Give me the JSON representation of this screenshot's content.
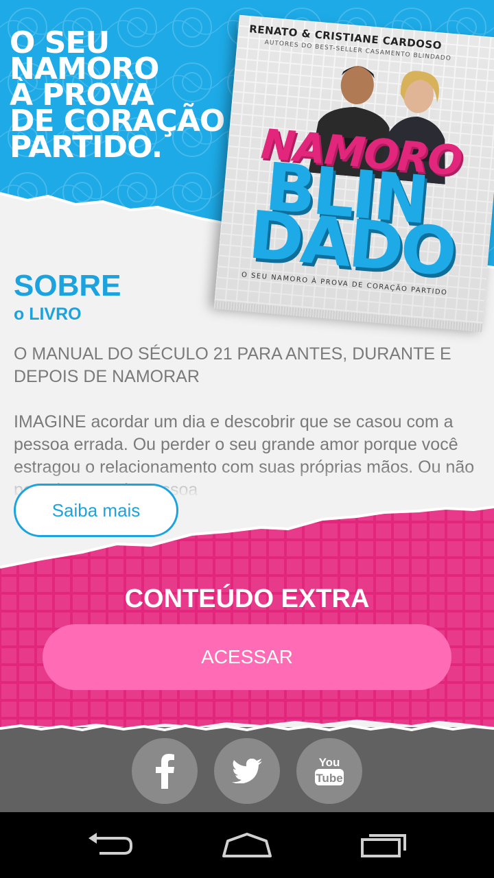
{
  "hero": {
    "headline": "O SEU\nNAMORO\nÀ PROVA\nDE CORAÇÃO\nPARTIDO.",
    "book": {
      "authors": "RENATO & CRISTIANE CARDOSO",
      "authors_note": "AUTORES DO BEST-SELLER CASAMENTO BLINDADO",
      "title_line1": "NAMORO",
      "title_line2": "BLIN",
      "title_line3": "DADO",
      "tagline": "O SEU NAMORO À PROVA DE CORAÇÃO PARTIDO"
    }
  },
  "about": {
    "title": "SOBRE",
    "subtitle": "o LIVRO",
    "paragraph1": "O MANUAL DO SÉCULO 21 PARA ANTES, DURANTE E DEPOIS DE NAMORAR",
    "paragraph2": "IMAGINE acordar um dia e descobrir que se casou com a pessoa errada. Ou perder o seu grande amor porque você estragou o relacionamento com suas próprias mãos. Ou não perceber aquela pessoa",
    "more_button": "Saiba mais"
  },
  "extra": {
    "title": "CONTEÚDO EXTRA",
    "access_button": "ACESSAR"
  },
  "social": {
    "facebook": "facebook-icon",
    "twitter": "twitter-icon",
    "youtube_label": "You Tube"
  },
  "navbar": {
    "back": "back-icon",
    "home": "home-icon",
    "recents": "recents-icon"
  },
  "colors": {
    "blue": "#1daae7",
    "pink": "#e2267c",
    "pink_button": "#ff6cb5",
    "footer": "#616161",
    "text_gray": "#7a7a7a"
  }
}
